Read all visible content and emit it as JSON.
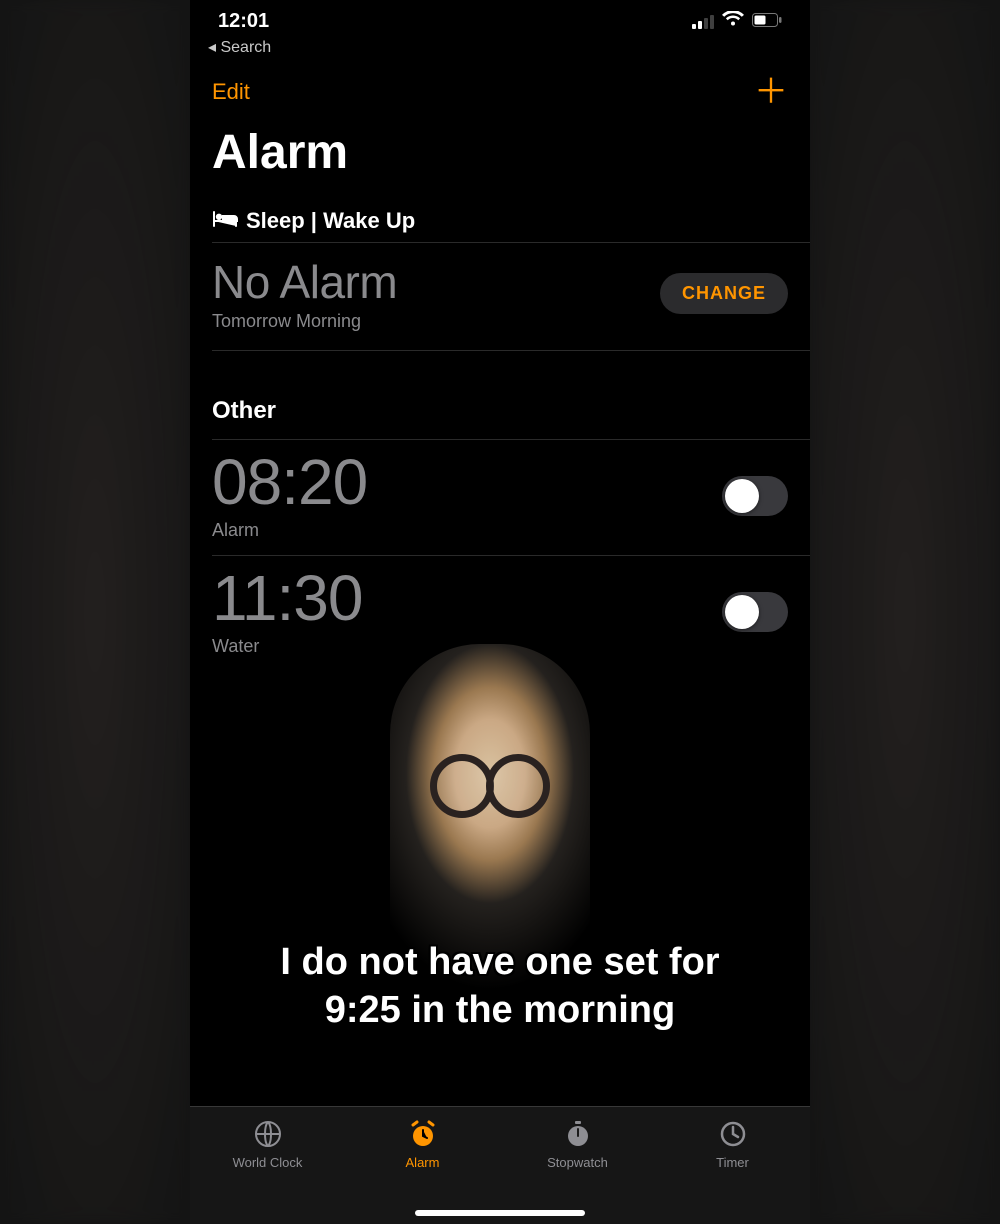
{
  "status": {
    "time": "12:01",
    "back_label": "Search"
  },
  "nav": {
    "edit": "Edit",
    "plus": "＋"
  },
  "title": "Alarm",
  "sleep": {
    "header": "Sleep | Wake Up",
    "main": "No Alarm",
    "sub": "Tomorrow Morning",
    "change": "CHANGE"
  },
  "other": {
    "header": "Other",
    "alarms": [
      {
        "time": "08:20",
        "label": "Alarm",
        "on": false
      },
      {
        "time": "11:30",
        "label": "Water",
        "on": false
      }
    ]
  },
  "caption_line1": "I do not have one set for",
  "caption_line2": "9:25 in the morning",
  "tabs": {
    "world": "World Clock",
    "alarm": "Alarm",
    "stopwatch": "Stopwatch",
    "timer": "Timer"
  }
}
